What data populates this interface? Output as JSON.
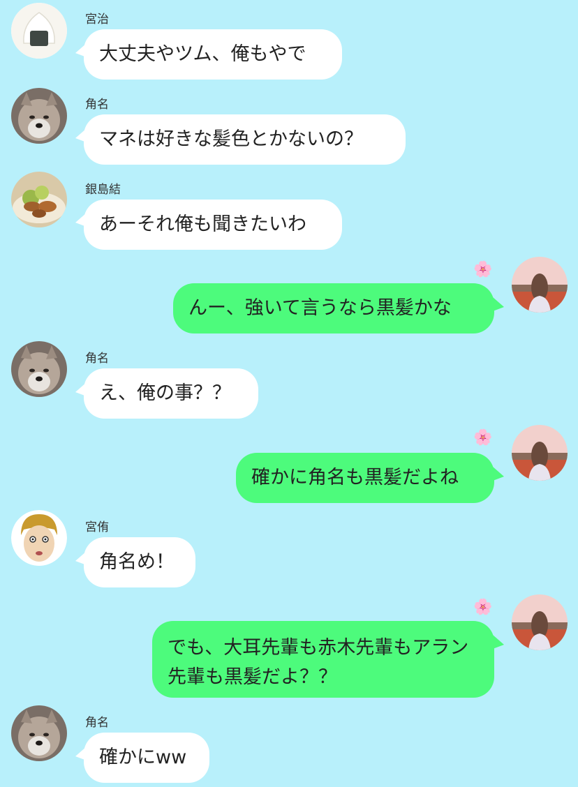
{
  "messages": [
    {
      "sender": "宮治",
      "text": "大丈夫やツム、俺もやで",
      "avatar": "onigiri-avatar"
    },
    {
      "sender": "角名",
      "text": "マネは好きな髪色とかないの？",
      "avatar": "shiba-dog-avatar"
    },
    {
      "sender": "銀島結",
      "text": "あーそれ俺も聞きたいわ",
      "avatar": "food-plate-avatar"
    },
    {
      "sender": "",
      "text": "んー、強いて言うなら黒髪かな",
      "avatar": "girl-in-field-avatar",
      "sticker": "🌸"
    },
    {
      "sender": "角名",
      "text": "え、俺の事？？",
      "avatar": "shiba-dog-avatar"
    },
    {
      "sender": "",
      "text": "確かに角名も黒髪だよね",
      "avatar": "girl-in-field-avatar",
      "sticker": "🌸"
    },
    {
      "sender": "宮侑",
      "text": "角名め！",
      "avatar": "cartoon-face-avatar"
    },
    {
      "sender": "",
      "text": "でも、大耳先輩も赤木先輩もアラン先輩も黒髪だよ？？",
      "avatar": "girl-in-field-avatar",
      "sticker": "🌸"
    },
    {
      "sender": "角名",
      "text": "確かにww",
      "avatar": "shiba-dog-avatar"
    }
  ],
  "colors": {
    "background": "#b8f0fb",
    "incoming_bubble": "#ffffff",
    "outgoing_bubble": "#4dfb7c"
  }
}
